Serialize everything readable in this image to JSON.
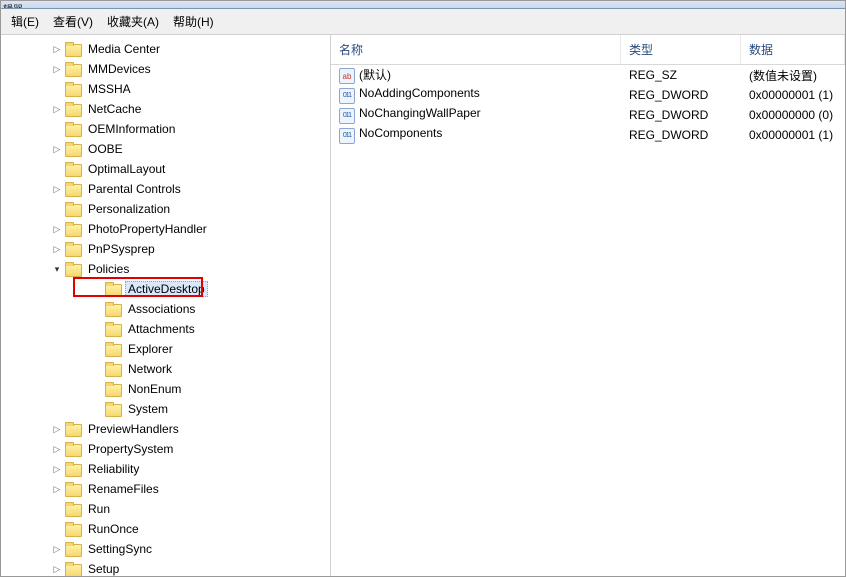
{
  "titlebar_fragment": "辑器",
  "menu": {
    "edit": "辑(E)",
    "view": "查看(V)",
    "favorites": "收藏夹(A)",
    "help": "帮助(H)"
  },
  "tree": {
    "indent_base": 48,
    "indent_child": 88,
    "items": [
      {
        "label": "Media Center",
        "exp": "closed"
      },
      {
        "label": "MMDevices",
        "exp": "closed"
      },
      {
        "label": "MSSHA",
        "exp": "none"
      },
      {
        "label": "NetCache",
        "exp": "closed"
      },
      {
        "label": "OEMInformation",
        "exp": "none"
      },
      {
        "label": "OOBE",
        "exp": "closed"
      },
      {
        "label": "OptimalLayout",
        "exp": "none"
      },
      {
        "label": "Parental Controls",
        "exp": "closed"
      },
      {
        "label": "Personalization",
        "exp": "none"
      },
      {
        "label": "PhotoPropertyHandler",
        "exp": "closed"
      },
      {
        "label": "PnPSysprep",
        "exp": "closed"
      },
      {
        "label": "Policies",
        "exp": "open"
      },
      {
        "label": "ActiveDesktop",
        "exp": "none",
        "child": true,
        "selected": true,
        "highlight": true
      },
      {
        "label": "Associations",
        "exp": "none",
        "child": true
      },
      {
        "label": "Attachments",
        "exp": "none",
        "child": true
      },
      {
        "label": "Explorer",
        "exp": "none",
        "child": true
      },
      {
        "label": "Network",
        "exp": "none",
        "child": true
      },
      {
        "label": "NonEnum",
        "exp": "none",
        "child": true
      },
      {
        "label": "System",
        "exp": "none",
        "child": true
      },
      {
        "label": "PreviewHandlers",
        "exp": "closed"
      },
      {
        "label": "PropertySystem",
        "exp": "closed"
      },
      {
        "label": "Reliability",
        "exp": "closed"
      },
      {
        "label": "RenameFiles",
        "exp": "closed"
      },
      {
        "label": "Run",
        "exp": "none"
      },
      {
        "label": "RunOnce",
        "exp": "none"
      },
      {
        "label": "SettingSync",
        "exp": "closed"
      },
      {
        "label": "Setup",
        "exp": "closed"
      }
    ]
  },
  "list": {
    "headers": {
      "name": "名称",
      "type": "类型",
      "data": "数据"
    },
    "rows": [
      {
        "icon": "str",
        "name": "(默认)",
        "type": "REG_SZ",
        "data": "(数值未设置)"
      },
      {
        "icon": "bin",
        "name": "NoAddingComponents",
        "type": "REG_DWORD",
        "data": "0x00000001 (1)"
      },
      {
        "icon": "bin",
        "name": "NoChangingWallPaper",
        "type": "REG_DWORD",
        "data": "0x00000000 (0)"
      },
      {
        "icon": "bin",
        "name": "NoComponents",
        "type": "REG_DWORD",
        "data": "0x00000001 (1)"
      }
    ],
    "icon_glyphs": {
      "str": "ab",
      "bin": "011\n110"
    }
  }
}
